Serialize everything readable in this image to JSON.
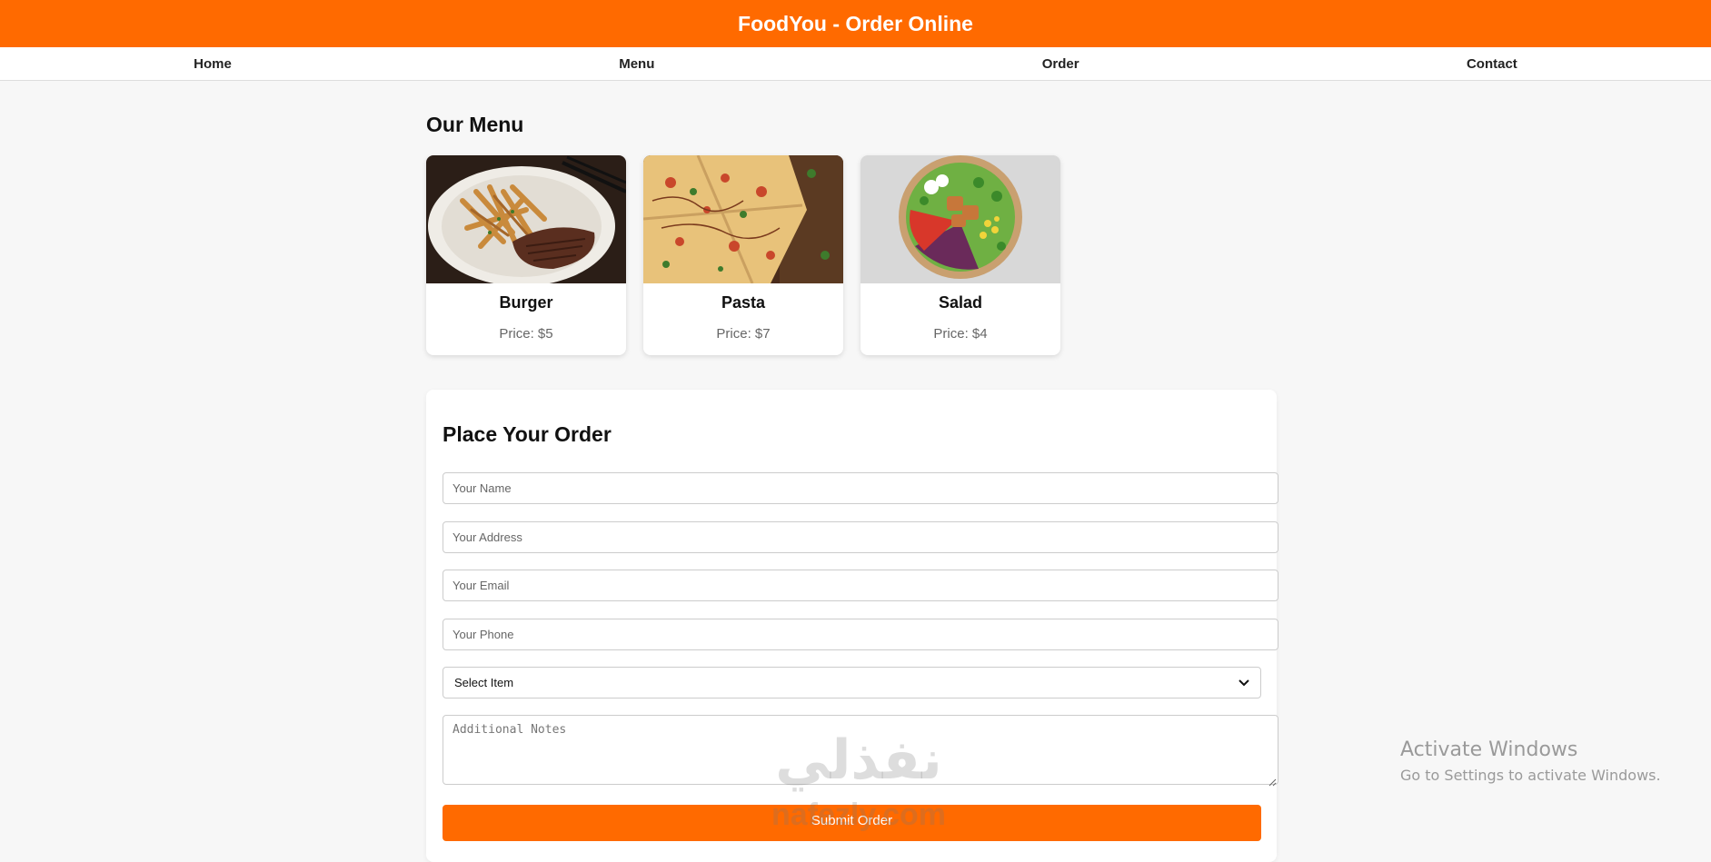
{
  "header": {
    "title": "FoodYou - Order Online",
    "color": "#ff6a00"
  },
  "nav": {
    "items": [
      {
        "label": "Home"
      },
      {
        "label": "Menu"
      },
      {
        "label": "Order"
      },
      {
        "label": "Contact"
      }
    ]
  },
  "menu": {
    "title": "Our Menu",
    "items": [
      {
        "name": "Burger",
        "price": "Price: $5",
        "image": "steak-and-fries-photo"
      },
      {
        "name": "Pasta",
        "price": "Price: $7",
        "image": "pizza-photo"
      },
      {
        "name": "Salad",
        "price": "Price: $4",
        "image": "salad-bowl-photo"
      }
    ]
  },
  "order": {
    "title": "Place Your Order",
    "name_placeholder": "Your Name",
    "address_placeholder": "Your Address",
    "email_placeholder": "Your Email",
    "phone_placeholder": "Your Phone",
    "select_value": "Select Item",
    "notes_placeholder": "Additional Notes",
    "submit_label": "Submit Order"
  },
  "watermark": {
    "arabic": "نفذلي",
    "latin": "nafezly.com"
  },
  "os_notice": {
    "title": "Activate Windows",
    "subtitle": "Go to Settings to activate Windows."
  }
}
